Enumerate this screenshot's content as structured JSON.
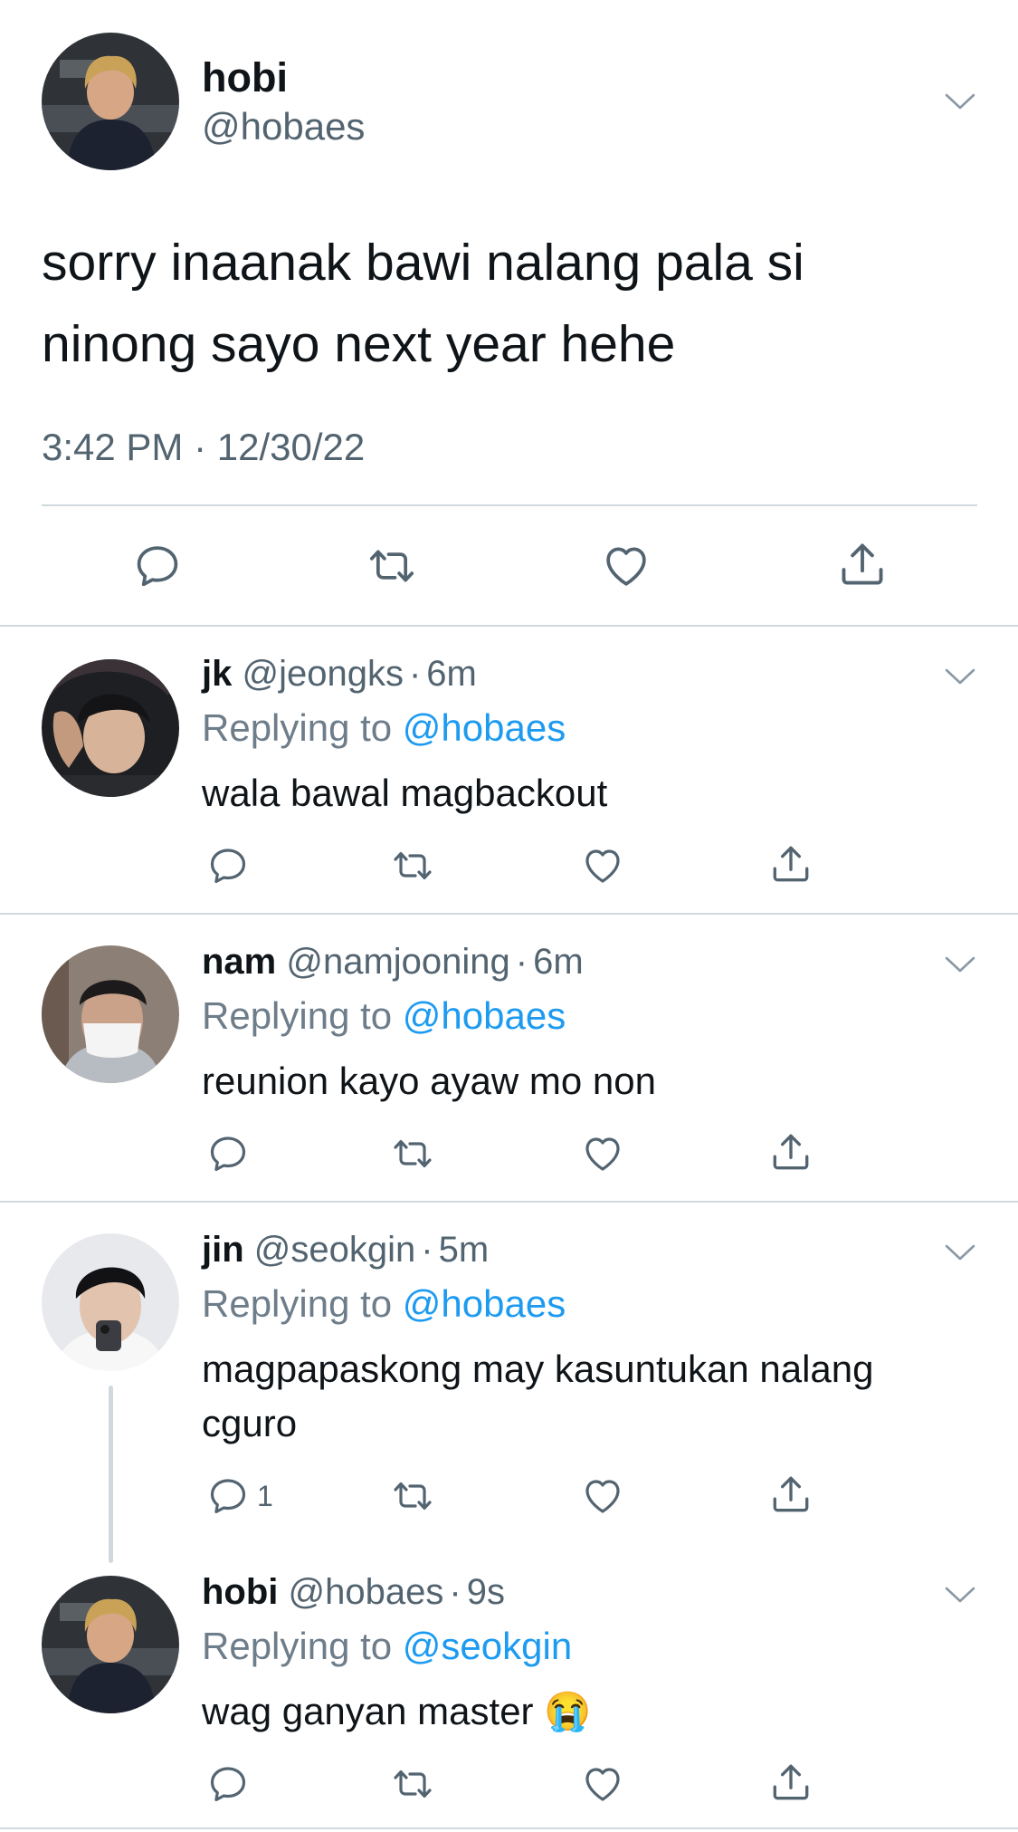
{
  "main_tweet": {
    "name": "hobi",
    "handle": "@hobaes",
    "text": "sorry inaanak bawi nalang pala si ninong sayo next year hehe",
    "timestamp": "3:42 PM · 12/30/22"
  },
  "replies": [
    {
      "name": "jk",
      "handle": "@jeongks",
      "separator": "·",
      "time": "6m",
      "replying_label": "Replying to",
      "replying_to": "@hobaes",
      "text": "wala bawal magbackout",
      "reply_count": ""
    },
    {
      "name": "nam",
      "handle": "@namjooning",
      "separator": "·",
      "time": "6m",
      "replying_label": "Replying to",
      "replying_to": "@hobaes",
      "text": "reunion kayo ayaw mo non",
      "reply_count": ""
    },
    {
      "name": "jin",
      "handle": "@seokgin",
      "separator": "·",
      "time": "5m",
      "replying_label": "Replying to",
      "replying_to": "@hobaes",
      "text": "magpapaskong may kasuntukan nalang cguro",
      "reply_count": "1"
    },
    {
      "name": "hobi",
      "handle": "@hobaes",
      "separator": "·",
      "time": "9s",
      "replying_label": "Replying to",
      "replying_to": "@seokgin",
      "text": "wag ganyan master 😭",
      "reply_count": ""
    }
  ],
  "icons": {
    "reply": "reply-icon",
    "retweet": "retweet-icon",
    "like": "heart-icon",
    "share": "share-icon",
    "more": "chevron-down-icon"
  },
  "colors": {
    "text": "#0f1419",
    "secondary": "#536471",
    "link": "#1d9bf0",
    "divider": "#cfd9de"
  }
}
